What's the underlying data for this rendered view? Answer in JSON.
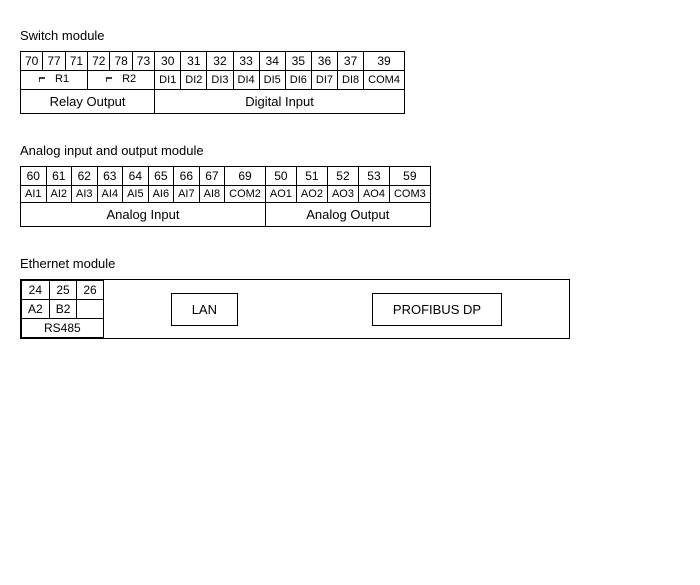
{
  "switch_module": {
    "title": "Switch module",
    "row1": [
      "70",
      "77",
      "71",
      "72",
      "78",
      "73",
      "30",
      "31",
      "32",
      "33",
      "34",
      "35",
      "36",
      "37",
      "39"
    ],
    "row2_relay": [
      "R1",
      "R2"
    ],
    "row2_digital": [
      "DI1",
      "DI2",
      "DI3",
      "DI4",
      "DI5",
      "DI6",
      "DI7",
      "DI8",
      "COM4"
    ],
    "group1_label": "Relay Output",
    "group2_label": "Digital Input"
  },
  "analog_module": {
    "title": "Analog input and output module",
    "row1": [
      "60",
      "61",
      "62",
      "63",
      "64",
      "65",
      "66",
      "67",
      "69",
      "50",
      "51",
      "52",
      "53",
      "59"
    ],
    "row2_input": [
      "AI1",
      "AI2",
      "AI3",
      "AI4",
      "AI5",
      "AI6",
      "AI7",
      "AI8",
      "COM2"
    ],
    "row2_output": [
      "AO1",
      "AO2",
      "AO3",
      "AO4",
      "COM3"
    ],
    "group1_label": "Analog Input",
    "group2_label": "Analog Output"
  },
  "ethernet_module": {
    "title": "Ethernet module",
    "row1": [
      "24",
      "25",
      "26"
    ],
    "row2": [
      "A2",
      "B2",
      ""
    ],
    "row3_label": "RS485",
    "lan_label": "LAN",
    "profibus_label": "PROFIBUS  DP"
  }
}
